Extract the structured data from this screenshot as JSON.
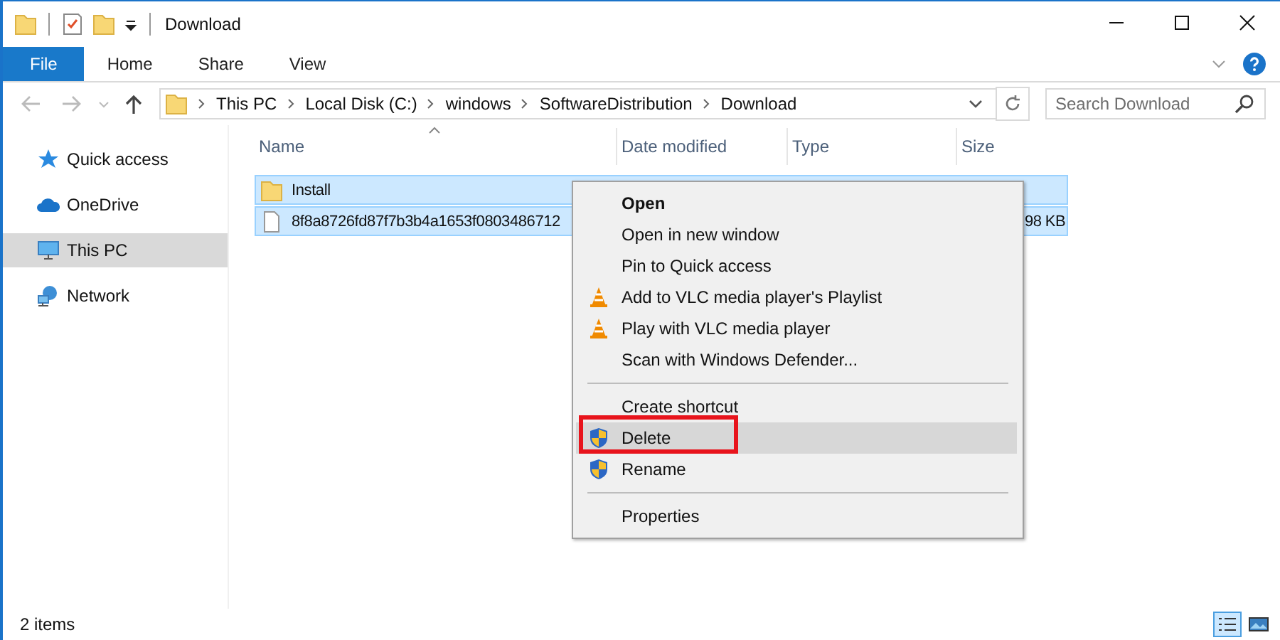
{
  "window": {
    "title": "Download"
  },
  "ribbon_tabs": [
    {
      "label": "File",
      "selected": true
    },
    {
      "label": "Home",
      "selected": false
    },
    {
      "label": "Share",
      "selected": false
    },
    {
      "label": "View",
      "selected": false
    }
  ],
  "address": {
    "segments": [
      "This PC",
      "Local Disk (C:)",
      "windows",
      "SoftwareDistribution",
      "Download"
    ]
  },
  "search": {
    "placeholder": "Search Download"
  },
  "sidebar": {
    "items": [
      {
        "label": "Quick access",
        "kind": "star",
        "selected": false
      },
      {
        "label": "OneDrive",
        "kind": "cloud",
        "selected": false
      },
      {
        "label": "This PC",
        "kind": "pc",
        "selected": true
      },
      {
        "label": "Network",
        "kind": "network",
        "selected": false
      }
    ]
  },
  "table": {
    "columns": [
      "Name",
      "Date modified",
      "Type",
      "Size"
    ],
    "rows": [
      {
        "kind": "folder",
        "name": "Install",
        "size": "",
        "selected": true
      },
      {
        "kind": "file",
        "name": "8f8a8726fd87f7b3b4a1653f0803486712",
        "size": "98 KB",
        "selected": true
      }
    ]
  },
  "context_menu": [
    {
      "label": "Open",
      "kind": "plain",
      "bold": true,
      "highlighted": false,
      "outlined": false
    },
    {
      "label": "Open in new window",
      "kind": "plain",
      "bold": false,
      "highlighted": false,
      "outlined": false
    },
    {
      "label": "Pin to Quick access",
      "kind": "plain",
      "bold": false,
      "highlighted": false,
      "outlined": false
    },
    {
      "label": "Add to VLC media player's Playlist",
      "kind": "vlc",
      "bold": false,
      "highlighted": false,
      "outlined": false
    },
    {
      "label": "Play with VLC media player",
      "kind": "vlc",
      "bold": false,
      "highlighted": false,
      "outlined": false
    },
    {
      "label": "Scan with Windows Defender...",
      "kind": "plain",
      "bold": false,
      "highlighted": false,
      "outlined": false
    },
    {
      "kind": "separator"
    },
    {
      "label": "Create shortcut",
      "kind": "plain",
      "bold": false,
      "highlighted": false,
      "outlined": false
    },
    {
      "label": "Delete",
      "kind": "uac",
      "bold": false,
      "highlighted": true,
      "outlined": true
    },
    {
      "label": "Rename",
      "kind": "uac",
      "bold": false,
      "highlighted": false,
      "outlined": false
    },
    {
      "kind": "separator"
    },
    {
      "label": "Properties",
      "kind": "plain",
      "bold": false,
      "highlighted": false,
      "outlined": false
    }
  ],
  "status_bar": {
    "count": "2 items"
  }
}
